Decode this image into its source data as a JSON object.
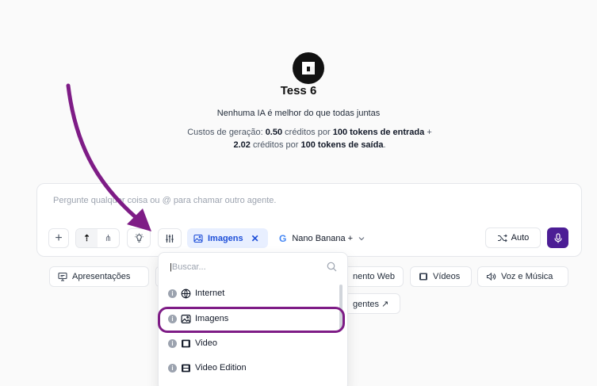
{
  "header": {
    "title": "Tess 6",
    "tagline": "Nenhuma IA é melhor do que todas juntas",
    "cost": {
      "prefix": "Custos de geração: ",
      "input_credits": "0.50",
      "mid1": " créditos por ",
      "input_tokens": "100 tokens de entrada",
      "suffix1": " +",
      "output_credits": "2.02",
      "mid2": " créditos por ",
      "output_tokens": "100 tokens de saída",
      "suffix2": "."
    }
  },
  "composer": {
    "placeholder": "Pergunte qualquer coisa ou @ para chamar outro agente.",
    "chip_label": "Imagens",
    "chip_close": "✕",
    "model": "Nano Banana +",
    "model_logo": "G",
    "auto_label": "Auto"
  },
  "suggestions": {
    "presentations": "Apresentações",
    "web": "nento Web",
    "videos": "Vídeos",
    "voice": "Voz e Música",
    "agents": "gentes ↗"
  },
  "dropdown": {
    "search_placeholder": "Buscar...",
    "items": [
      {
        "label": "Internet",
        "icon": "globe-icon"
      },
      {
        "label": "Imagens",
        "icon": "image-icon"
      },
      {
        "label": "Video",
        "icon": "film-icon"
      },
      {
        "label": "Video Edition",
        "icon": "film-edit-icon"
      }
    ],
    "info_badge": "i"
  },
  "colors": {
    "accent": "#4c1d95",
    "annotation": "#7e1c86",
    "chip_bg": "#e8efff",
    "chip_text": "#1d4ed8"
  }
}
